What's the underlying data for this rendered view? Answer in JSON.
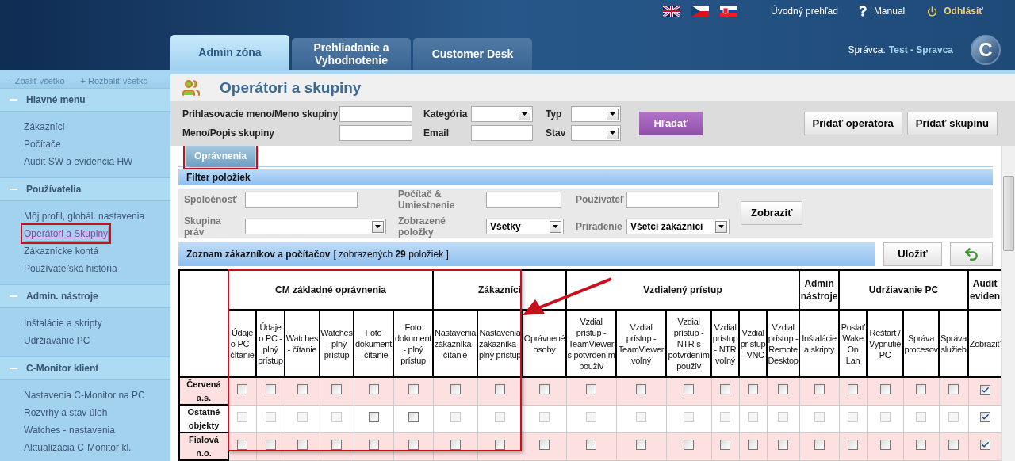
{
  "top_bar": {
    "home": "Úvodný prehľad",
    "manual": "Manual",
    "logout": "Odhlásiť"
  },
  "tabs": [
    {
      "label": "Admin zóna",
      "selected": true
    },
    {
      "label": "Prehliadanie a Vyhodnotenie",
      "selected": false
    },
    {
      "label": "Customer Desk",
      "selected": false
    }
  ],
  "user": {
    "label": "Správca:",
    "name": "Test - Spravca"
  },
  "logo_letter": "C",
  "sidebar": {
    "collapse_all": "- Zbaliť všetko",
    "expand_all": "+ Rozbaliť všetko",
    "sections": [
      {
        "title": "Hlavné menu",
        "expanded": true,
        "items": [
          {
            "label": "Zákazníci",
            "selected": false
          },
          {
            "label": "Počítače",
            "selected": false
          },
          {
            "label": "Audit SW a evidencia HW",
            "selected": false
          }
        ]
      },
      {
        "title": "Používatelia",
        "expanded": true,
        "items": [
          {
            "label": "Môj profil, globál. nastavenia",
            "selected": false
          },
          {
            "label": "Operátori a Skupiny",
            "selected": true
          },
          {
            "label": "Zákaznícke kontá",
            "selected": false
          },
          {
            "label": "Používateľská história",
            "selected": false
          }
        ]
      },
      {
        "title": "Admin. nástroje",
        "expanded": true,
        "items": [
          {
            "label": "Inštalácie a skripty",
            "selected": false
          },
          {
            "label": "Udržiavanie PC",
            "selected": false
          }
        ]
      },
      {
        "title": "C-Monitor klient",
        "expanded": true,
        "items": [
          {
            "label": "Nastavenia C-Monitor na PC",
            "selected": false
          },
          {
            "label": "Rozvrhy a stav úloh",
            "selected": false
          },
          {
            "label": "Watches - nastavenia",
            "selected": false
          },
          {
            "label": "Aktualizácia C-Monitor kl.",
            "selected": false
          }
        ]
      }
    ]
  },
  "page": {
    "title": "Operátori a skupiny"
  },
  "search": {
    "fields": [
      {
        "label": "Prihlasovacie meno/Meno skupiny",
        "kind": "text"
      },
      {
        "label": "Kategória",
        "kind": "select"
      },
      {
        "label": "Typ",
        "kind": "select"
      },
      {
        "label": "Meno/Popis skupiny",
        "kind": "text"
      },
      {
        "label": "Email",
        "kind": "text"
      },
      {
        "label": "Stav",
        "kind": "select"
      }
    ],
    "search_button": "Hľadať",
    "buttons": [
      "Pridať operátora",
      "Pridať skupinu"
    ]
  },
  "subtabs": [
    {
      "label": "Oprávnenia",
      "selected": true
    }
  ],
  "filter": {
    "title": "Filter položiek",
    "fields": [
      {
        "label": "Spoločnosť",
        "kind": "text"
      },
      {
        "label": "Počítač & Umiestnenie",
        "kind": "text"
      },
      {
        "label": "Používateľ",
        "kind": "text"
      },
      {
        "label": "Skupina práv",
        "kind": "select"
      },
      {
        "label": "Zobrazené položky",
        "kind": "select",
        "value": "Všetky"
      },
      {
        "label": "Priradenie",
        "kind": "select",
        "value": "Všetci zákazníci"
      }
    ],
    "button": "Zobraziť"
  },
  "list": {
    "title": "Zoznam zákazníkov a počítačov",
    "subtitle": "[ zobrazených **29** položiek ]",
    "save": "Uložiť"
  },
  "table": {
    "groups": [
      {
        "label": "CM základné oprávnenia",
        "columns": [
          "Údaje o PC - čítanie",
          "Údaje o PC - plný prístup",
          "Watches - čítanie",
          "Watches - plný prístup",
          "Foto dokument - čítanie",
          "Foto dokument - plný prístup"
        ]
      },
      {
        "label": "Zákazníci",
        "columns": [
          "Nastavenia zákazníka - čítanie",
          "Nastavenia zákazníka - plný prístup",
          "Oprávnené osoby"
        ]
      },
      {
        "label": "Vzdialený prístup",
        "columns": [
          "Vzdial prístup - TeamViewer s potvrdením použív",
          "Vzdial prístup - TeamViewer voľný",
          "Vzdial prístup - NTR s potvrdením použív",
          "Vzdial prístup - NTR voľný",
          "Vzdial prístup - VNC",
          "Vzdial prístup - Remote Desktop"
        ]
      },
      {
        "label": "Admin nástroje",
        "columns": [
          "Inštalácie a skripty"
        ]
      },
      {
        "label": "Udržiavanie PC",
        "columns": [
          "Poslať Wake On Lan",
          "Reštart / Vypnutie PC",
          "Správa procesov",
          "Správa služieb"
        ]
      },
      {
        "label": "Audit eviden",
        "columns": [
          "Zobraziť"
        ]
      }
    ],
    "rows": [
      {
        "label": "Červená a.s.",
        "highlighted": true,
        "cells": [
          {
            "checked": false,
            "disabled": false
          },
          {
            "checked": false,
            "disabled": false
          },
          {
            "checked": false,
            "disabled": false
          },
          {
            "checked": false,
            "disabled": false
          },
          {
            "checked": false,
            "disabled": false
          },
          {
            "checked": false,
            "disabled": false
          },
          {
            "checked": false,
            "disabled": false
          },
          {
            "checked": false,
            "disabled": false
          },
          {
            "checked": false,
            "disabled": false
          },
          {
            "checked": false,
            "disabled": false
          },
          {
            "checked": false,
            "disabled": false
          },
          {
            "checked": false,
            "disabled": false
          },
          {
            "checked": false,
            "disabled": false
          },
          {
            "checked": false,
            "disabled": false
          },
          {
            "checked": false,
            "disabled": false
          },
          {
            "checked": false,
            "disabled": false
          },
          {
            "checked": false,
            "disabled": false
          },
          {
            "checked": false,
            "disabled": false
          },
          {
            "checked": false,
            "disabled": false
          },
          {
            "checked": false,
            "disabled": false
          },
          {
            "checked": true,
            "disabled": false
          }
        ]
      },
      {
        "label": "Ostatné objekty",
        "highlighted": false,
        "cells": [
          {
            "checked": false,
            "disabled": true
          },
          {
            "checked": false,
            "disabled": true
          },
          {
            "checked": false,
            "disabled": true
          },
          {
            "checked": false,
            "disabled": true
          },
          {
            "checked": false,
            "disabled": false
          },
          {
            "checked": false,
            "disabled": false
          },
          {
            "checked": false,
            "disabled": true
          },
          {
            "checked": false,
            "disabled": true
          },
          {
            "checked": false,
            "disabled": true
          },
          {
            "checked": false,
            "disabled": true
          },
          {
            "checked": false,
            "disabled": true
          },
          {
            "checked": false,
            "disabled": true
          },
          {
            "checked": false,
            "disabled": true
          },
          {
            "checked": false,
            "disabled": true
          },
          {
            "checked": false,
            "disabled": true
          },
          {
            "checked": false,
            "disabled": true
          },
          {
            "checked": false,
            "disabled": true
          },
          {
            "checked": false,
            "disabled": true
          },
          {
            "checked": false,
            "disabled": true
          },
          {
            "checked": false,
            "disabled": true
          },
          {
            "checked": true,
            "disabled": false
          }
        ]
      },
      {
        "label": "Fialová n.o.",
        "highlighted": true,
        "cells": [
          {
            "checked": false,
            "disabled": false
          },
          {
            "checked": false,
            "disabled": false
          },
          {
            "checked": false,
            "disabled": false
          },
          {
            "checked": false,
            "disabled": false
          },
          {
            "checked": false,
            "disabled": false
          },
          {
            "checked": false,
            "disabled": false
          },
          {
            "checked": false,
            "disabled": false
          },
          {
            "checked": false,
            "disabled": false
          },
          {
            "checked": false,
            "disabled": false
          },
          {
            "checked": false,
            "disabled": false
          },
          {
            "checked": false,
            "disabled": false
          },
          {
            "checked": false,
            "disabled": false
          },
          {
            "checked": false,
            "disabled": false
          },
          {
            "checked": false,
            "disabled": false
          },
          {
            "checked": false,
            "disabled": false
          },
          {
            "checked": false,
            "disabled": false
          },
          {
            "checked": false,
            "disabled": false
          },
          {
            "checked": false,
            "disabled": false
          },
          {
            "checked": false,
            "disabled": false
          },
          {
            "checked": false,
            "disabled": false
          },
          {
            "checked": true,
            "disabled": false
          }
        ]
      }
    ]
  }
}
